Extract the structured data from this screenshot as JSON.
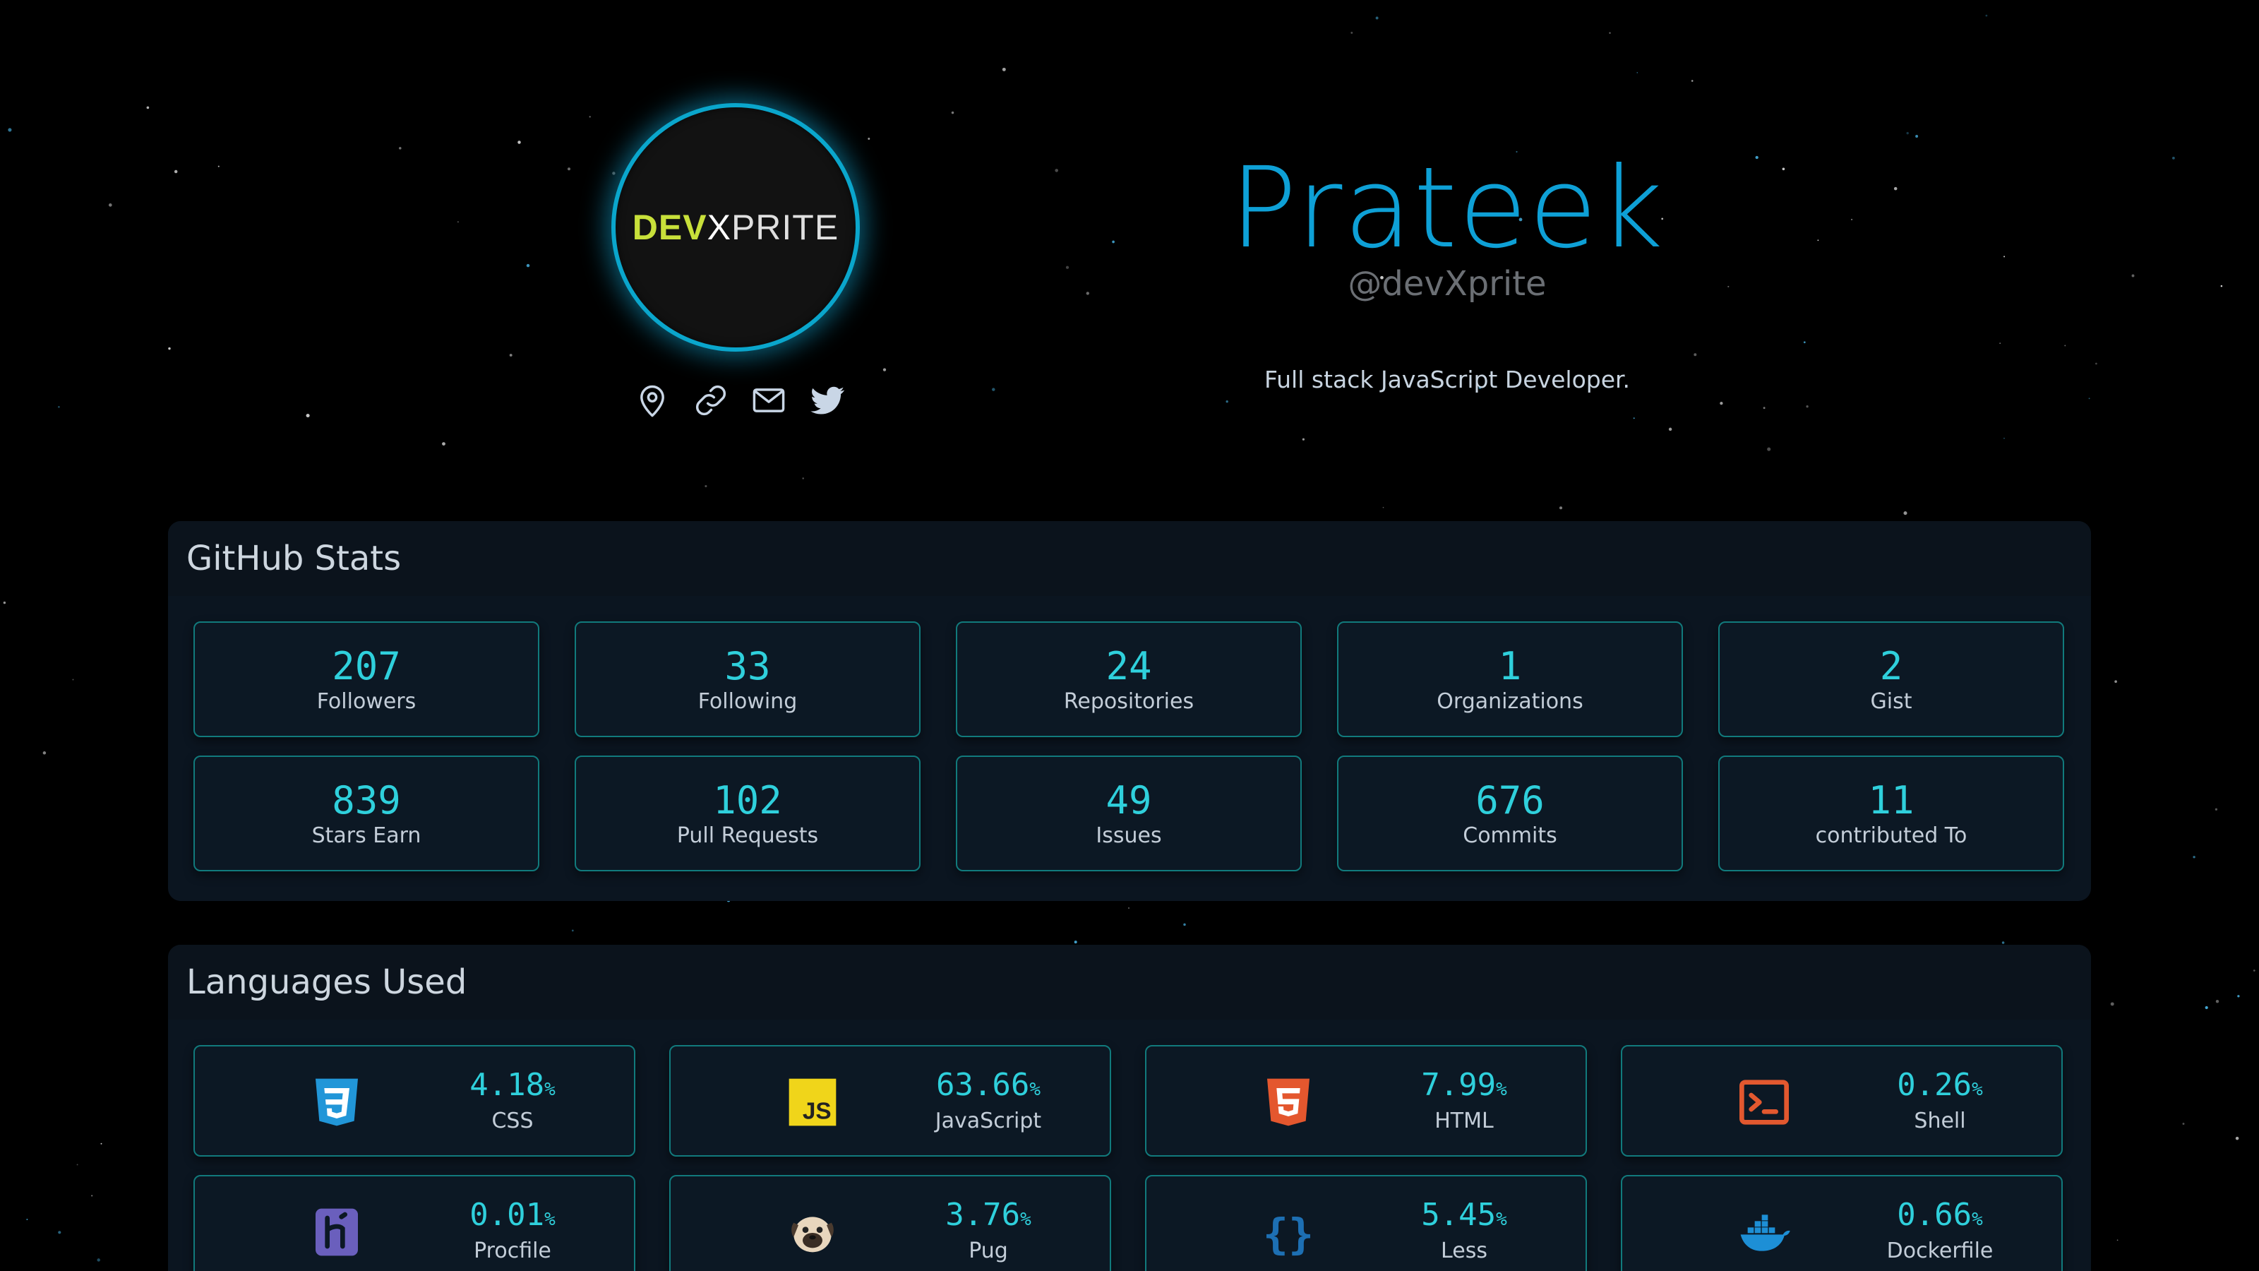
{
  "profile": {
    "logo": {
      "dev": "DEV",
      "x": "X",
      "prite": "PRITE"
    },
    "name": "Prateek",
    "handle": "@devXprite",
    "bio": "Full stack JavaScript Developer.",
    "social_icons": [
      "location-icon",
      "link-icon",
      "mail-icon",
      "twitter-icon"
    ]
  },
  "github_stats": {
    "title": "GitHub Stats",
    "items": [
      {
        "value": "207",
        "label": "Followers"
      },
      {
        "value": "33",
        "label": "Following"
      },
      {
        "value": "24",
        "label": "Repositories"
      },
      {
        "value": "1",
        "label": "Organizations"
      },
      {
        "value": "2",
        "label": "Gist"
      },
      {
        "value": "839",
        "label": "Stars Earn"
      },
      {
        "value": "102",
        "label": "Pull Requests"
      },
      {
        "value": "49",
        "label": "Issues"
      },
      {
        "value": "676",
        "label": "Commits"
      },
      {
        "value": "11",
        "label": "contributed To"
      }
    ]
  },
  "languages": {
    "title": "Languages Used",
    "unit": "%",
    "items": [
      {
        "percent": "4.18",
        "name": "CSS",
        "icon": "css3-icon"
      },
      {
        "percent": "63.66",
        "name": "JavaScript",
        "icon": "javascript-icon"
      },
      {
        "percent": "7.99",
        "name": "HTML",
        "icon": "html5-icon"
      },
      {
        "percent": "0.26",
        "name": "Shell",
        "icon": "terminal-icon"
      },
      {
        "percent": "0.01",
        "name": "Procfile",
        "icon": "heroku-icon"
      },
      {
        "percent": "3.76",
        "name": "Pug",
        "icon": "pug-icon"
      },
      {
        "percent": "5.45",
        "name": "Less",
        "icon": "curly-braces-icon"
      },
      {
        "percent": "0.66",
        "name": "Dockerfile",
        "icon": "docker-icon"
      }
    ]
  },
  "colors": {
    "accent": "#0ea0d6",
    "stat_value": "#2fd0dc",
    "card_border": "#117a7c",
    "panel_bg": "#0b1520",
    "background": "#000000"
  }
}
